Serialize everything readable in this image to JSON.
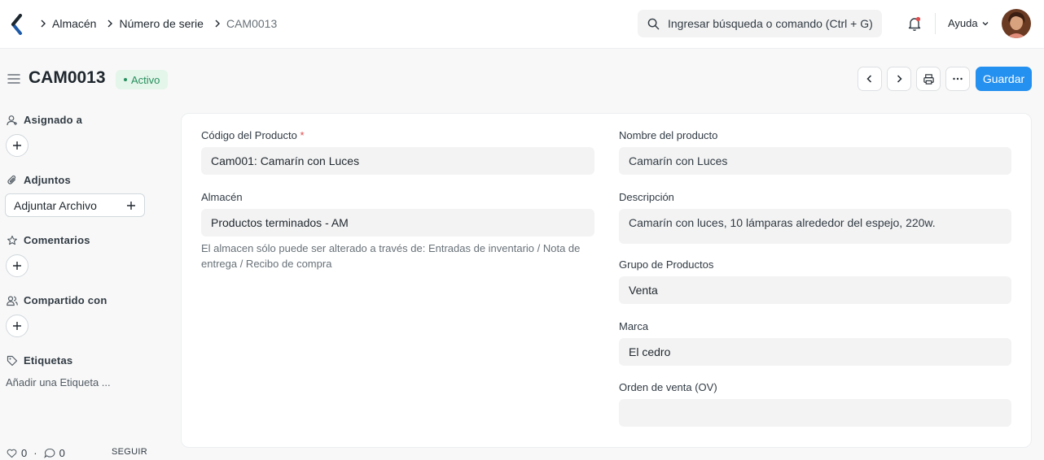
{
  "navbar": {
    "breadcrumbs": [
      "Almacén",
      "Número de serie",
      "CAM0013"
    ],
    "search_placeholder": "Ingresar búsqueda o comando (Ctrl + G)",
    "help_label": "Ayuda"
  },
  "page": {
    "title": "CAM0013",
    "status": "Activo",
    "save_label": "Guardar"
  },
  "sidebar": {
    "assigned_to": "Asignado a",
    "attachments": "Adjuntos",
    "attach_file": "Adjuntar Archivo",
    "comments": "Comentarios",
    "shared_with": "Compartido con",
    "tags": "Etiquetas",
    "add_tag": "Añadir una Etiqueta ...",
    "likes": "0",
    "comment_count": "0",
    "follow": "SEGUIR"
  },
  "form": {
    "product_code_label": "Código del Producto",
    "product_code": "Cam001: Camarín con Luces",
    "warehouse_label": "Almacén",
    "warehouse": "Productos terminados - AM",
    "warehouse_help": "El almacen sólo puede ser alterado a través de: Entradas de inventario / Nota de entrega / Recibo de compra",
    "product_name_label": "Nombre del producto",
    "product_name": "Camarín con Luces",
    "description_label": "Descripción",
    "description": "Camarín con luces, 10 lámparas alrededor del espejo, 220w.",
    "product_group_label": "Grupo de Productos",
    "product_group": "Venta",
    "brand_label": "Marca",
    "brand": "El cedro",
    "sales_order_label": "Orden de venta (OV)",
    "sales_order": ""
  },
  "colors": {
    "primary": "#2490ef",
    "status_bg": "#e4f5e9",
    "status_text": "#278f5e"
  }
}
